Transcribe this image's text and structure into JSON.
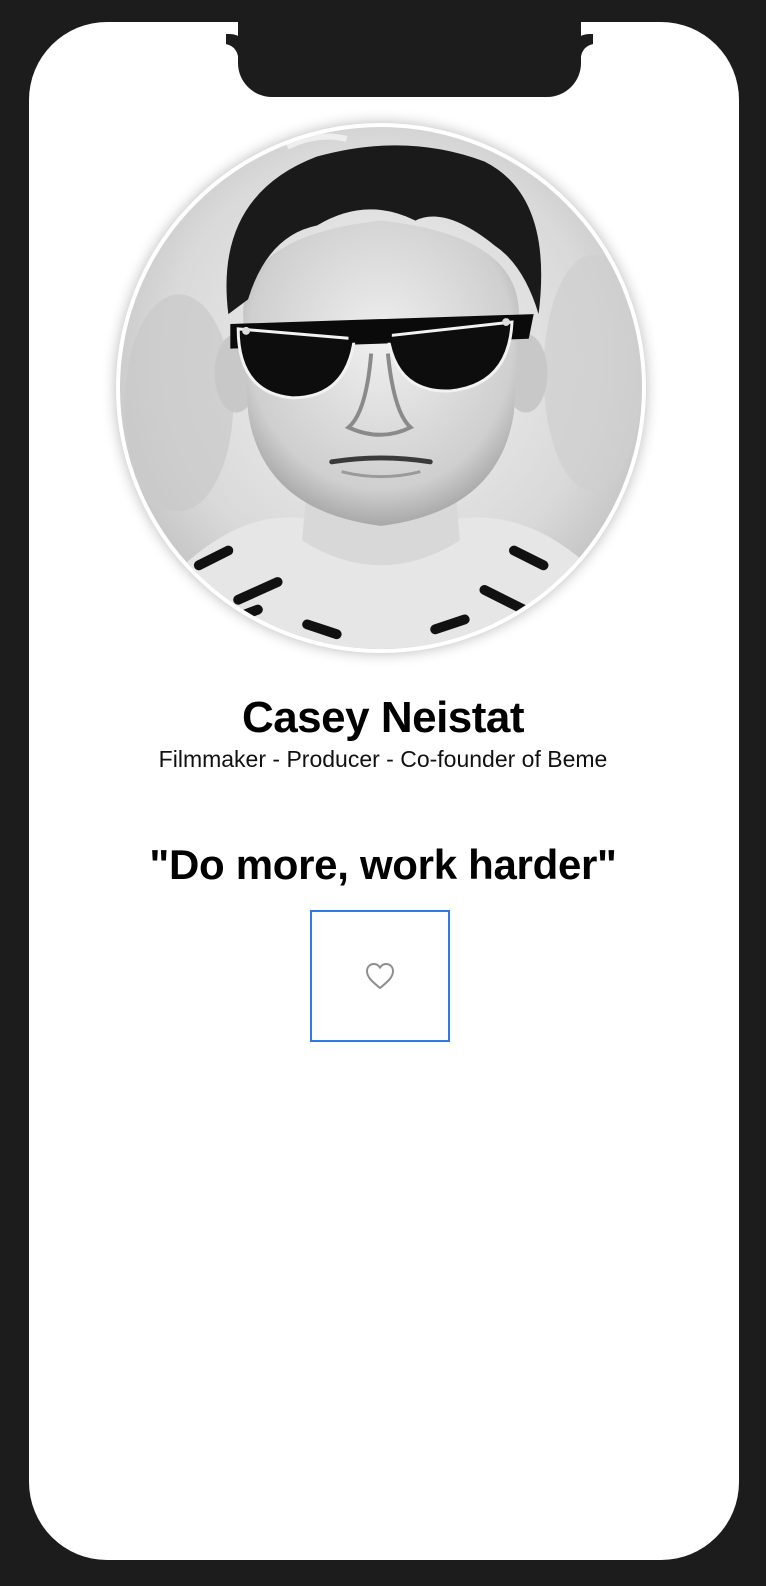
{
  "profile": {
    "name": "Casey Neistat",
    "subtitle": "Filmmaker - Producer - Co-founder of Beme",
    "quote": "\"Do more, work harder\""
  },
  "avatar": {
    "icon": "profile-photo"
  },
  "like_button": {
    "icon": "heart-outline-icon",
    "accent_color": "#2f7ae5"
  },
  "colors": {
    "device_frame": "#1c1c1c",
    "screen_background": "#ffffff",
    "text": "#000000"
  }
}
